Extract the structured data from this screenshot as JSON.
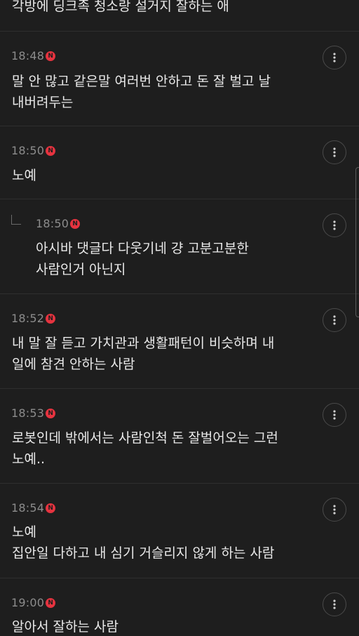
{
  "top_comment": {
    "text": "각방에 딩크족 청소랑 설거지 잘하는 애"
  },
  "comments": [
    {
      "time": "18:48",
      "badge": "N",
      "lines": [
        "말 안 많고 같은말 여러번 안하고 돈 잘 벌고 날",
        "내버려두는"
      ]
    },
    {
      "time": "18:50",
      "badge": "N",
      "lines": [
        "노예"
      ]
    },
    {
      "time": "18:50",
      "badge": "N",
      "reply": true,
      "lines": [
        "아시바 댓글다 다웃기네 걍 고분고분한",
        "사람인거 아닌지"
      ]
    },
    {
      "time": "18:52",
      "badge": "N",
      "lines": [
        "내 말 잘 듣고 가치관과 생활패턴이 비슷하며 내",
        "일에 참견 안하는 사람"
      ]
    },
    {
      "time": "18:53",
      "badge": "N",
      "lines": [
        "로봇인데 밖에서는 사람인척 돈 잘벌어오는 그런",
        "노예.."
      ]
    },
    {
      "time": "18:54",
      "badge": "N",
      "lines": [
        "노예",
        "집안일 다하고 내 심기 거슬리지 않게 하는 사람"
      ]
    },
    {
      "time": "19:00",
      "badge": "N",
      "lines": [
        "알아서 잘하는 사람"
      ]
    }
  ],
  "icons": {
    "more": "more-vertical-icon",
    "new_badge": "new-badge-icon",
    "reply": "reply-arrow-icon"
  },
  "colors": {
    "background": "#1e1e1e",
    "text": "#e9e9e9",
    "time": "#8c8c8c",
    "badge": "#e5333f",
    "divider": "#2e2e2e"
  }
}
